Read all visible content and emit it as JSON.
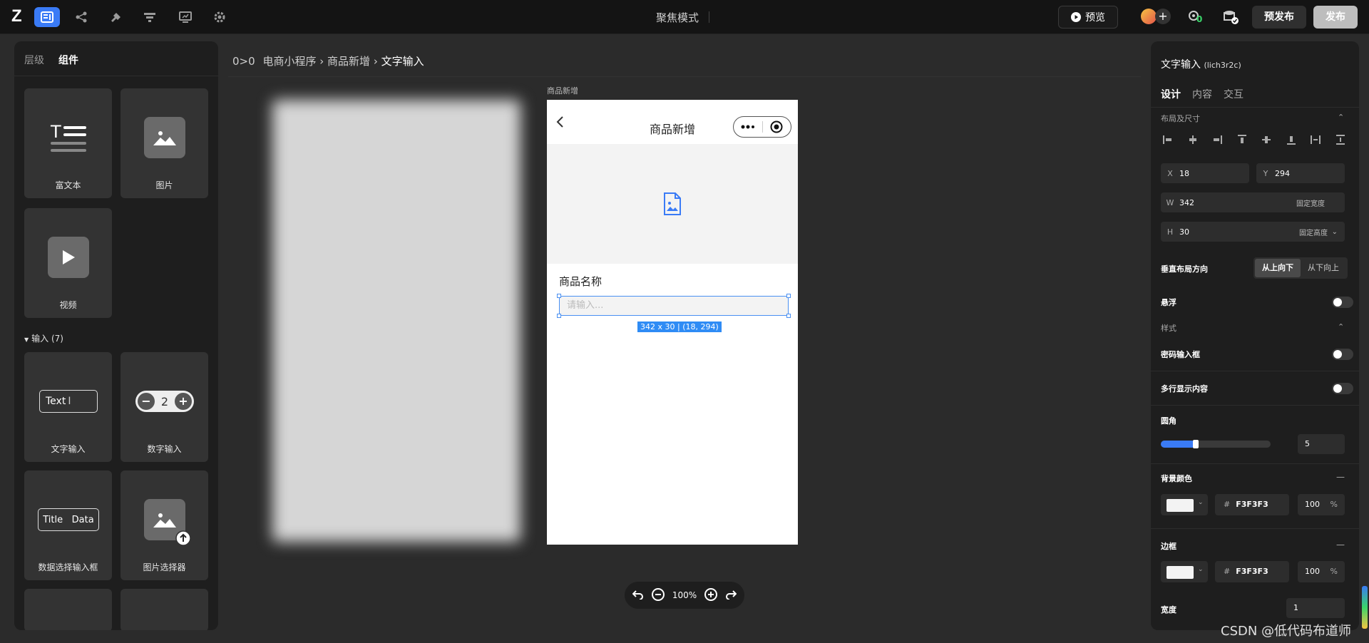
{
  "topbar": {
    "logo": "Z",
    "focus_mode": "聚焦模式",
    "preview_label": "预览",
    "prepublish_label": "预发布",
    "publish_label": "发布",
    "badge_count": "0",
    "icons": [
      "layout-icon",
      "flow-icon",
      "plugin-icon",
      "pipeline-icon",
      "monitor-icon",
      "settings-icon"
    ]
  },
  "left_panel": {
    "tabs": [
      "层级",
      "组件"
    ],
    "active_tab": "组件",
    "components": [
      {
        "label": "富文本",
        "icon": "rich-text-icon"
      },
      {
        "label": "图片",
        "icon": "image-icon"
      },
      {
        "label": "视频",
        "icon": "video-icon"
      }
    ],
    "input_section": "输入 (7)",
    "input_components": [
      {
        "label": "文字输入",
        "sample": "Text"
      },
      {
        "label": "数字输入",
        "sample": "2"
      },
      {
        "label": "数据选择输入框",
        "sample_title": "Title",
        "sample_data": "Data"
      },
      {
        "label": "图片选择器"
      }
    ]
  },
  "breadcrumb": {
    "icon": "0>0",
    "items": [
      "电商小程序",
      "商品新增"
    ],
    "current": "文字输入"
  },
  "canvas": {
    "frame_label": "商品新增",
    "page_title": "商品新增",
    "field_label": "商品名称",
    "input_placeholder": "请输入...",
    "size_tag": "342 x 30 | (18, 294)",
    "zoom": "100%"
  },
  "right_panel": {
    "title": "文字输入",
    "component_id": "(lich3r2c)",
    "tabs": [
      "设计",
      "内容",
      "交互"
    ],
    "active_tab": "设计",
    "layout_section": "布局及尺寸",
    "x_label": "X",
    "x_value": "18",
    "y_label": "Y",
    "y_value": "294",
    "w_label": "W",
    "w_value": "342",
    "w_mode": "固定宽度",
    "h_label": "H",
    "h_value": "30",
    "h_mode": "固定高度",
    "vertical_direction_label": "垂直布局方向",
    "dir_options": [
      "从上向下",
      "从下向上"
    ],
    "dir_selected": "从上向下",
    "float_label": "悬浮",
    "style_section": "样式",
    "password_label": "密码输入框",
    "multiline_label": "多行显示内容",
    "radius_label": "圆角",
    "radius_value": "5",
    "radius_fill": 0.32,
    "bg_color_label": "背景颜色",
    "bg_hex": "F3F3F3",
    "bg_opacity": "100",
    "border_label": "边框",
    "border_hex": "F3F3F3",
    "border_opacity": "100",
    "width_label": "宽度",
    "width_value": "1",
    "pct": "%",
    "hash": "#"
  },
  "watermark": "CSDN @低代码布道师",
  "colors": {
    "accent": "#3a7bf6",
    "canvas_bg": "#2b2b2b",
    "panel_bg": "#1e1e1e"
  }
}
